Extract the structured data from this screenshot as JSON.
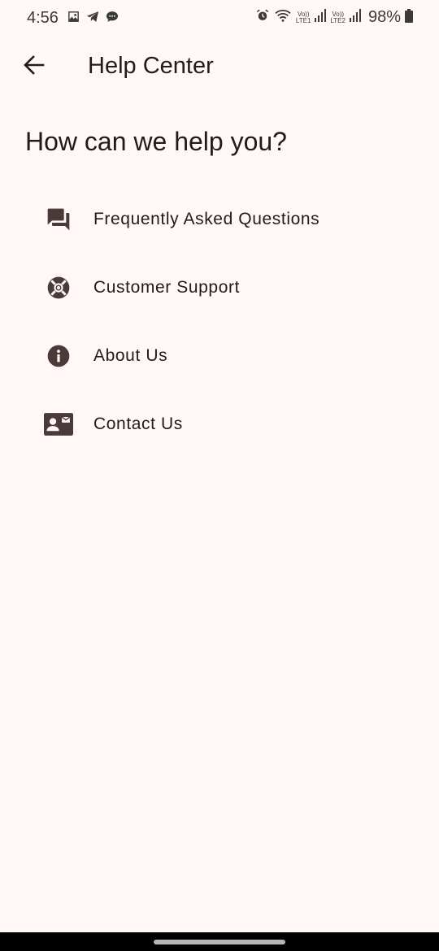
{
  "status_bar": {
    "time": "4:56",
    "left_icons": [
      "gallery-icon",
      "telegram-icon",
      "chat-bubble-icon"
    ],
    "right_icons": [
      "alarm-icon",
      "wifi-icon",
      "signal-lte1-icon",
      "signal-lte2-icon",
      "battery-icon"
    ],
    "sim1_label_top": "Vo))",
    "sim1_label_bottom": "LTE1",
    "sim2_label_top": "Vo))",
    "sim2_label_bottom": "LTE2",
    "battery": "98%"
  },
  "app_bar": {
    "back_icon": "arrow-back-icon",
    "title": "Help Center"
  },
  "heading": "How can we help you?",
  "menu": {
    "items": [
      {
        "label": "Frequently Asked Questions",
        "icon": "forum-icon"
      },
      {
        "label": "Customer Support",
        "icon": "support-lifebuoy-icon"
      },
      {
        "label": "About Us",
        "icon": "info-icon"
      },
      {
        "label": "Contact Us",
        "icon": "contact-mail-icon"
      }
    ]
  },
  "colors": {
    "background": "#fff8f6",
    "text": "#231a19",
    "icon": "#4a3b3a",
    "nav_bar": "#000000"
  }
}
